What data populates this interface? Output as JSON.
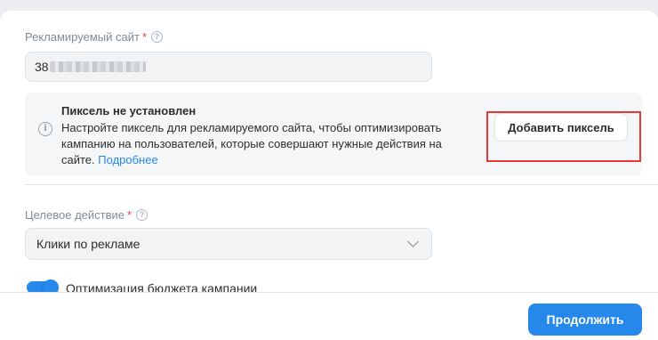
{
  "site": {
    "label": "Рекламируемый сайт",
    "required_mark": "*",
    "help_icon": "question-circle-icon",
    "value_visible_prefix": "38"
  },
  "pixel_notice": {
    "icon": "info-circle-icon",
    "title": "Пиксель не установлен",
    "text": "Настройте пиксель для рекламируемого сайта, чтобы оптимизировать кампанию на пользователей, которые совершают нужные действия на сайте.",
    "link": "Подробнее",
    "button": "Добавить пиксель",
    "highlight_color": "#e53935"
  },
  "goal": {
    "label": "Целевое действие",
    "required_mark": "*",
    "help_icon": "question-circle-icon",
    "selected": "Клики по рекламе",
    "chevron_icon": "chevron-down-icon"
  },
  "budget_optimization": {
    "label": "Оптимизация бюджета кампании",
    "enabled": true
  },
  "footer": {
    "continue": "Продолжить"
  },
  "colors": {
    "accent": "#2688eb",
    "required": "#e64646"
  }
}
